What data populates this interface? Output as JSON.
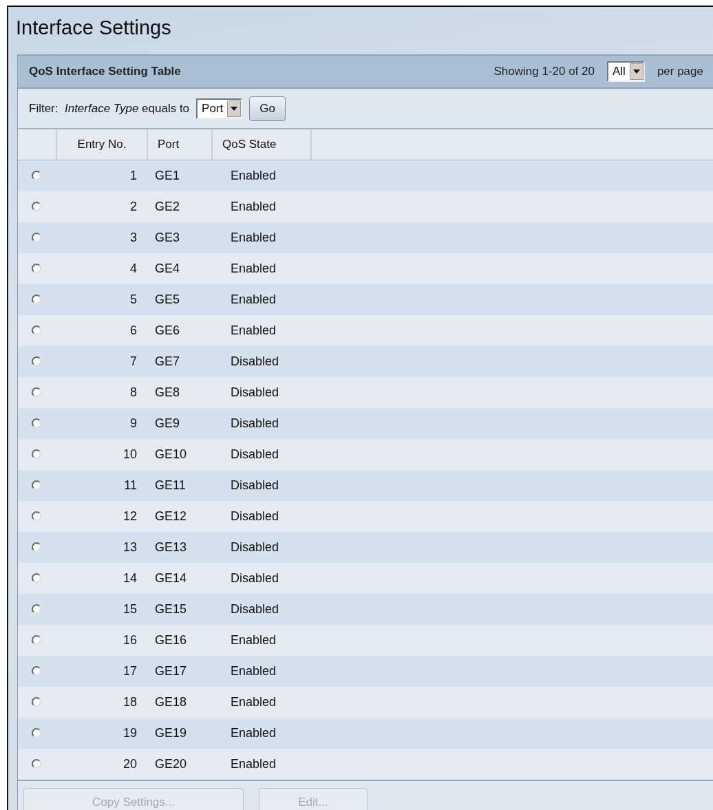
{
  "page": {
    "title": "Interface Settings"
  },
  "table": {
    "title": "QoS Interface Setting Table",
    "showing": "Showing 1-20 of 20",
    "per_page_value": "All",
    "per_page_label": "per page",
    "filter": {
      "label": "Filter:",
      "field": "Interface Type",
      "operator": "equals to",
      "value": "Port",
      "button": "Go"
    },
    "columns": [
      "Entry No.",
      "Port",
      "QoS State"
    ],
    "rows": [
      {
        "selected": false,
        "entry": "1",
        "port": "GE1",
        "state": "Enabled"
      },
      {
        "selected": false,
        "entry": "2",
        "port": "GE2",
        "state": "Enabled"
      },
      {
        "selected": false,
        "entry": "3",
        "port": "GE3",
        "state": "Enabled"
      },
      {
        "selected": false,
        "entry": "4",
        "port": "GE4",
        "state": "Enabled"
      },
      {
        "selected": false,
        "entry": "5",
        "port": "GE5",
        "state": "Enabled"
      },
      {
        "selected": false,
        "entry": "6",
        "port": "GE6",
        "state": "Enabled"
      },
      {
        "selected": false,
        "entry": "7",
        "port": "GE7",
        "state": "Disabled"
      },
      {
        "selected": false,
        "entry": "8",
        "port": "GE8",
        "state": "Disabled"
      },
      {
        "selected": false,
        "entry": "9",
        "port": "GE9",
        "state": "Disabled"
      },
      {
        "selected": false,
        "entry": "10",
        "port": "GE10",
        "state": "Disabled"
      },
      {
        "selected": false,
        "entry": "11",
        "port": "GE11",
        "state": "Disabled"
      },
      {
        "selected": false,
        "entry": "12",
        "port": "GE12",
        "state": "Disabled"
      },
      {
        "selected": false,
        "entry": "13",
        "port": "GE13",
        "state": "Disabled"
      },
      {
        "selected": false,
        "entry": "14",
        "port": "GE14",
        "state": "Disabled"
      },
      {
        "selected": false,
        "entry": "15",
        "port": "GE15",
        "state": "Disabled"
      },
      {
        "selected": false,
        "entry": "16",
        "port": "GE16",
        "state": "Enabled"
      },
      {
        "selected": false,
        "entry": "17",
        "port": "GE17",
        "state": "Enabled"
      },
      {
        "selected": false,
        "entry": "18",
        "port": "GE18",
        "state": "Enabled"
      },
      {
        "selected": false,
        "entry": "19",
        "port": "GE19",
        "state": "Enabled"
      },
      {
        "selected": false,
        "entry": "20",
        "port": "GE20",
        "state": "Enabled"
      }
    ],
    "buttons": [
      {
        "label": "Copy Settings...",
        "disabled": true
      },
      {
        "label": "Edit...",
        "disabled": true
      }
    ]
  }
}
